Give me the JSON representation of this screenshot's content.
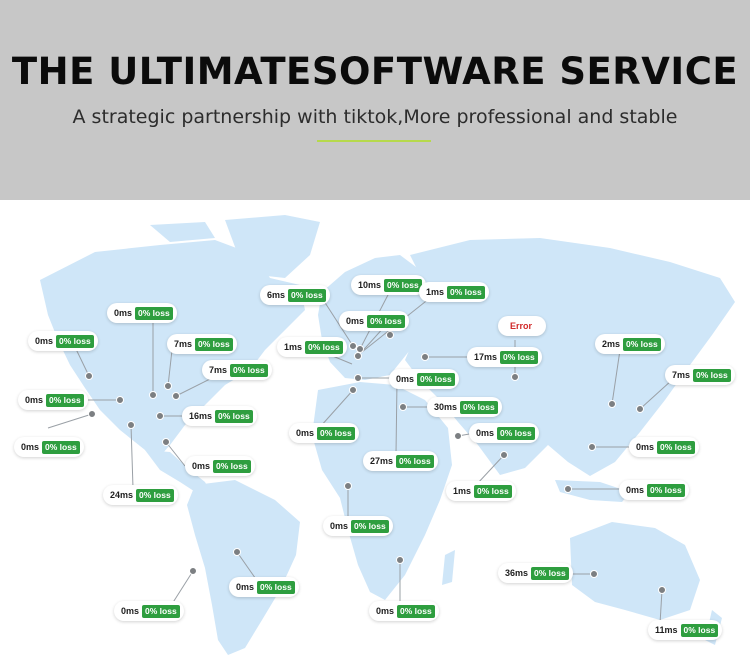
{
  "header": {
    "title": "THE ULTIMATESOFTWARE SERVICE",
    "subtitle": "A strategic partnership with tiktok,More professional and stable"
  },
  "colors": {
    "header_bg": "#c7c7c7",
    "accent_line": "#b6d94c",
    "map_land": "#cfe6f8",
    "loss_badge": "#2e9e3f",
    "error_text": "#d12b2b"
  },
  "nodes": [
    {
      "latency": "6ms",
      "loss": "0% loss"
    },
    {
      "latency": "10ms",
      "loss": "0% loss"
    },
    {
      "latency": "1ms",
      "loss": "0% loss"
    },
    {
      "latency": "0ms",
      "loss": "0% loss"
    },
    {
      "latency": "0ms",
      "loss": "0% loss"
    },
    {
      "latency": "0ms",
      "loss": "0% loss"
    },
    {
      "latency": "7ms",
      "loss": "0% loss"
    },
    {
      "latency": "1ms",
      "loss": "0% loss"
    },
    {
      "latency": "7ms",
      "loss": "0% loss"
    },
    {
      "latency": "0ms",
      "loss": "0% loss"
    },
    {
      "latency": "16ms",
      "loss": "0% loss"
    },
    {
      "latency": "0ms",
      "loss": "0% loss"
    },
    {
      "latency": "0ms",
      "loss": "0% loss"
    },
    {
      "latency": "24ms",
      "loss": "0% loss"
    },
    {
      "latency": "0ms",
      "loss": "0% loss"
    },
    {
      "latency": "0ms",
      "loss": "0% loss"
    },
    {
      "latency": "0ms",
      "loss": "0% loss"
    },
    {
      "latency": "27ms",
      "loss": "0% loss"
    },
    {
      "latency": "30ms",
      "loss": "0% loss"
    },
    {
      "latency": "0ms",
      "loss": "0% loss"
    },
    {
      "latency": "17ms",
      "loss": "0% loss"
    },
    {
      "latency": "0ms",
      "loss": "0% loss"
    },
    {
      "latency": "1ms",
      "loss": "0% loss"
    },
    {
      "latency": "2ms",
      "loss": "0% loss"
    },
    {
      "latency": "7ms",
      "loss": "0% loss"
    },
    {
      "latency": "0ms",
      "loss": "0% loss"
    },
    {
      "latency": "0ms",
      "loss": "0% loss"
    },
    {
      "latency": "36ms",
      "loss": "0% loss"
    },
    {
      "latency": "11ms",
      "loss": "0% loss"
    },
    {
      "latency": "0ms",
      "loss": "0% loss"
    },
    {
      "latency": "0ms",
      "loss": "0% loss"
    }
  ],
  "error_node": {
    "label": "Error"
  }
}
